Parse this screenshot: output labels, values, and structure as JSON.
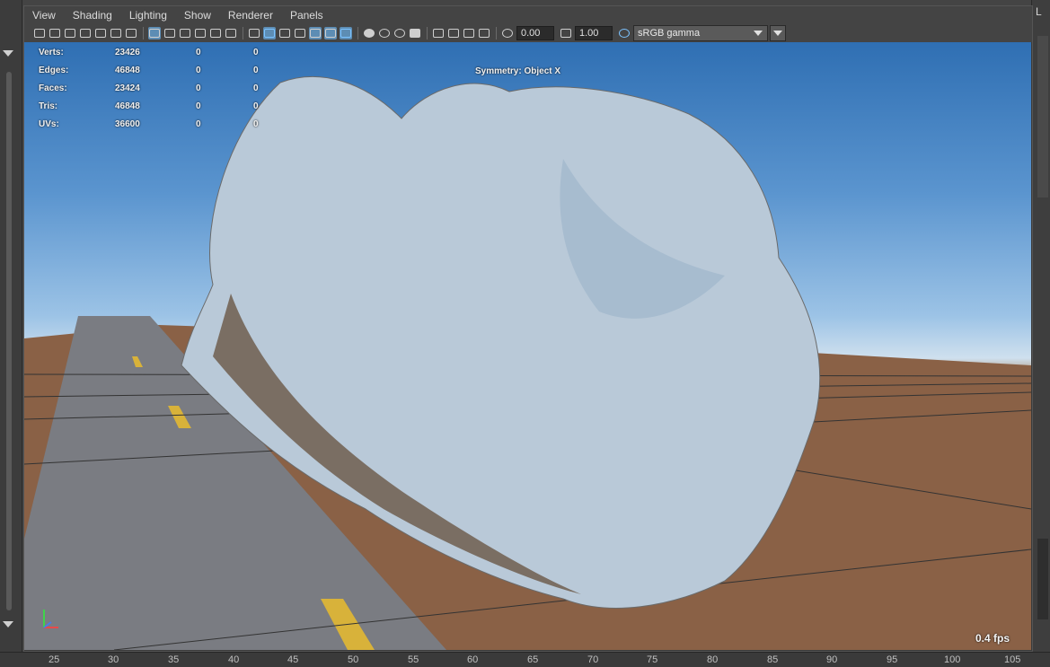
{
  "menu": [
    "View",
    "Shading",
    "Lighting",
    "Show",
    "Renderer",
    "Panels"
  ],
  "toolbar": {
    "exposure_value": "0.00",
    "gamma_value": "1.00",
    "color_space": "sRGB gamma"
  },
  "right_panel": {
    "label": "L"
  },
  "hud": {
    "stats": [
      {
        "label": "Verts:",
        "value": "23426",
        "selected": "0",
        "components": "0"
      },
      {
        "label": "Edges:",
        "value": "46848",
        "selected": "0",
        "components": "0"
      },
      {
        "label": "Faces:",
        "value": "23424",
        "selected": "0",
        "components": "0"
      },
      {
        "label": "Tris:",
        "value": "46848",
        "selected": "0",
        "components": "0"
      },
      {
        "label": "UVs:",
        "value": "36600",
        "selected": "0",
        "components": "0"
      }
    ],
    "symmetry": "Symmetry: Object X",
    "fps": "0.4 fps"
  },
  "timeline": {
    "ticks": [
      "25",
      "30",
      "35",
      "40",
      "45",
      "50",
      "55",
      "60",
      "65",
      "70",
      "75",
      "80",
      "85",
      "90",
      "95",
      "100",
      "105"
    ]
  },
  "colors": {
    "accent": "#5d8db4",
    "ui_bg": "#444444"
  }
}
